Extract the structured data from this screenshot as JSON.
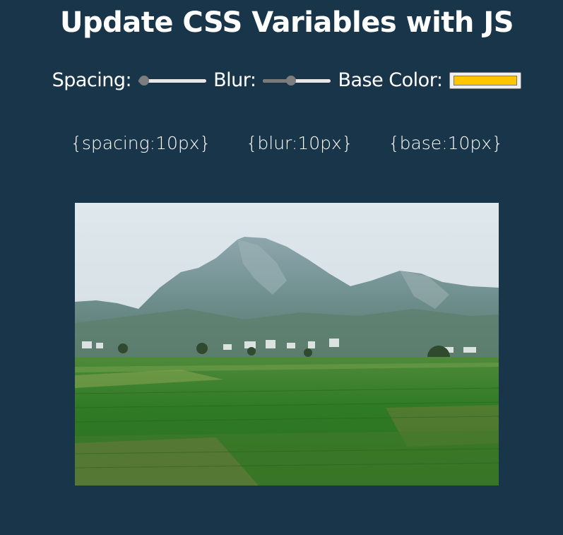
{
  "header": {
    "title": "Update CSS Variables with JS"
  },
  "controls": {
    "spacing": {
      "label": "Spacing:",
      "value": 0.08
    },
    "blur": {
      "label": "Blur:",
      "value": 0.41
    },
    "base_color": {
      "label": "Base Color:",
      "value": "#ffc600"
    }
  },
  "values": {
    "spacing_text": "{spacing:10px}",
    "blur_text": "{blur:10px}",
    "base_text": "{base:10px}"
  },
  "colors": {
    "background": "#193549",
    "accent": "#ffc600"
  },
  "image": {
    "description_icon": "landscape-photo-icon"
  }
}
